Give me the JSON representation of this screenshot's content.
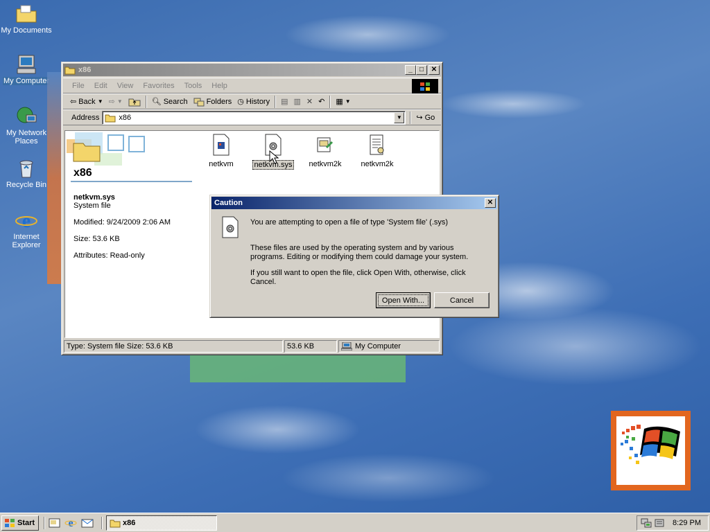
{
  "desktop": {
    "icons": [
      {
        "label": "My Documents",
        "icon": "my-documents-icon"
      },
      {
        "label": "My Computer",
        "icon": "my-computer-icon"
      },
      {
        "label": "My Network Places",
        "icon": "network-places-icon"
      },
      {
        "label": "Recycle Bin",
        "icon": "recycle-bin-icon"
      },
      {
        "label": "Internet Explorer",
        "icon": "internet-explorer-icon"
      }
    ]
  },
  "explorer": {
    "title": "x86",
    "menu": [
      "File",
      "Edit",
      "View",
      "Favorites",
      "Tools",
      "Help"
    ],
    "toolbar": {
      "back": "Back",
      "search": "Search",
      "folders": "Folders",
      "history": "History"
    },
    "address": {
      "label": "Address",
      "value": "x86",
      "go": "Go"
    },
    "folder_name": "x86",
    "details": {
      "name": "netkvm.sys",
      "type": "System file",
      "modified": "Modified: 9/24/2009 2:06 AM",
      "size": "Size: 53.6 KB",
      "attributes": "Attributes: Read-only"
    },
    "files": [
      {
        "name": "netkvm"
      },
      {
        "name": "netkvm.sys"
      },
      {
        "name": "netkvm2k"
      },
      {
        "name": "netkvm2k"
      }
    ],
    "status": {
      "type": "Type: System file Size: 53.6 KB",
      "size": "53.6 KB",
      "zone": "My Computer"
    }
  },
  "dialog": {
    "title": "Caution",
    "line1": "You are attempting to open a file of type 'System file' (.sys)",
    "line2": "These files are used by the operating system and by various programs. Editing or modifying them could damage your system.",
    "line3": "If you still want to open the file, click Open With, otherwise, click Cancel.",
    "open_with": "Open With...",
    "cancel": "Cancel"
  },
  "taskbar": {
    "start": "Start",
    "task": "x86",
    "clock": "8:29 PM"
  }
}
